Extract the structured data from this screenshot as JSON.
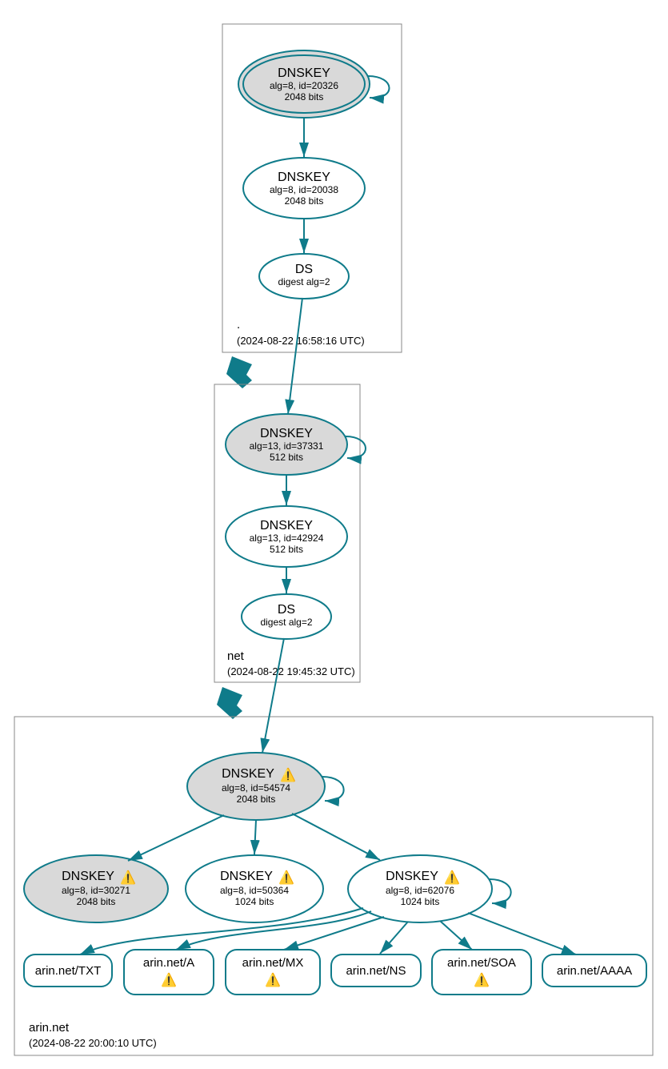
{
  "zones": {
    "root": {
      "label": ".",
      "timestamp": "(2024-08-22 16:58:16 UTC)"
    },
    "net": {
      "label": "net",
      "timestamp": "(2024-08-22 19:45:32 UTC)"
    },
    "arin": {
      "label": "arin.net",
      "timestamp": "(2024-08-22 20:00:10 UTC)"
    }
  },
  "nodes": {
    "root_ksk": {
      "title": "DNSKEY",
      "line2": "alg=8, id=20326",
      "line3": "2048 bits",
      "warn": false
    },
    "root_zsk": {
      "title": "DNSKEY",
      "line2": "alg=8, id=20038",
      "line3": "2048 bits",
      "warn": false
    },
    "root_ds": {
      "title": "DS",
      "line2": "digest alg=2",
      "line3": "",
      "warn": false
    },
    "net_ksk": {
      "title": "DNSKEY",
      "line2": "alg=13, id=37331",
      "line3": "512 bits",
      "warn": false
    },
    "net_zsk": {
      "title": "DNSKEY",
      "line2": "alg=13, id=42924",
      "line3": "512 bits",
      "warn": false
    },
    "net_ds": {
      "title": "DS",
      "line2": "digest alg=2",
      "line3": "",
      "warn": false
    },
    "arin_ksk": {
      "title": "DNSKEY",
      "line2": "alg=8, id=54574",
      "line3": "2048 bits",
      "warn": true
    },
    "arin_k2": {
      "title": "DNSKEY",
      "line2": "alg=8, id=30271",
      "line3": "2048 bits",
      "warn": true
    },
    "arin_k3": {
      "title": "DNSKEY",
      "line2": "alg=8, id=50364",
      "line3": "1024 bits",
      "warn": true
    },
    "arin_k4": {
      "title": "DNSKEY",
      "line2": "alg=8, id=62076",
      "line3": "1024 bits",
      "warn": true
    }
  },
  "rrsets": {
    "txt": {
      "label": "arin.net/TXT",
      "warn": false
    },
    "a": {
      "label": "arin.net/A",
      "warn": true
    },
    "mx": {
      "label": "arin.net/MX",
      "warn": true
    },
    "ns": {
      "label": "arin.net/NS",
      "warn": false
    },
    "soa": {
      "label": "arin.net/SOA",
      "warn": true
    },
    "aaaa": {
      "label": "arin.net/AAAA",
      "warn": false
    }
  },
  "warn_glyph": "⚠️"
}
